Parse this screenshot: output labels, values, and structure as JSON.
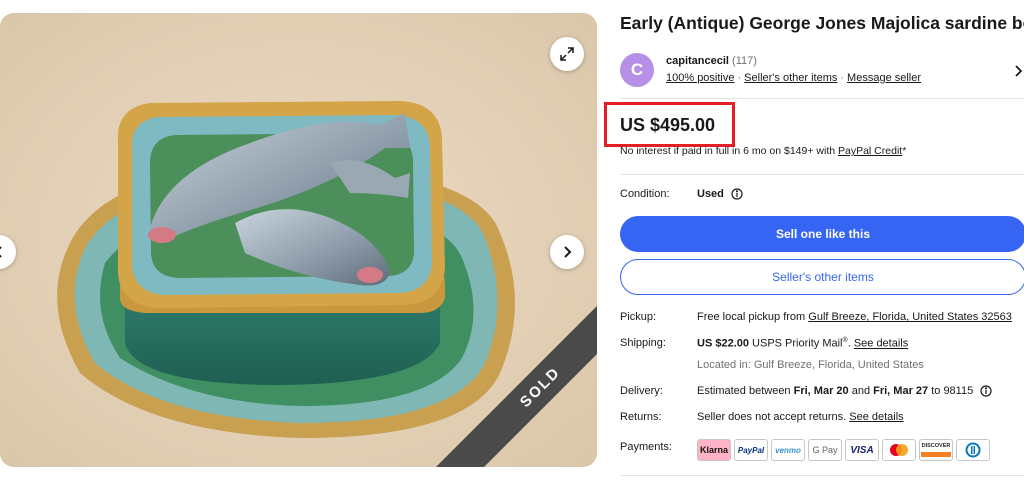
{
  "listing": {
    "title": "Early (Antique) George Jones Majolica sardine box",
    "sold_label": "SOLD"
  },
  "seller": {
    "avatar_letter": "C",
    "name": "capitancecil",
    "feedback_count": "(117)",
    "positive": "100% positive",
    "other_items_link": "Seller's other items",
    "message_link": "Message seller"
  },
  "price": {
    "amount": "US $495.00",
    "financing_text": "No interest if paid in full in 6 mo on $149+ with ",
    "financing_link": "PayPal Credit",
    "financing_suffix": "*",
    "highlight_color": "#e31e24"
  },
  "condition": {
    "label": "Condition:",
    "value": "Used"
  },
  "buttons": {
    "primary": "Sell one like this",
    "secondary": "Seller's other items"
  },
  "details": {
    "pickup_label": "Pickup:",
    "pickup_text": "Free local pickup from ",
    "pickup_link": "Gulf Breeze, Florida, United States 32563",
    "shipping_label": "Shipping:",
    "shipping_price": "US $22.00",
    "shipping_service": " USPS Priority Mail",
    "shipping_reg": "®",
    "shipping_dot": ". ",
    "shipping_link": "See details",
    "location": "Located in: Gulf Breeze, Florida, United States",
    "delivery_label": "Delivery:",
    "delivery_prefix": "Estimated between ",
    "delivery_start": "Fri, Mar 20",
    "delivery_and": " and ",
    "delivery_end": "Fri, Mar 27",
    "delivery_suffix": " to 98115",
    "returns_label": "Returns:",
    "returns_text": "Seller does not accept returns. ",
    "returns_link": "See details",
    "payments_label": "Payments:"
  },
  "payments": [
    {
      "name": "Klarna",
      "icon": "klarna-icon",
      "color": "#ffb3c7",
      "text_color": "#17120f"
    },
    {
      "name": "PayPal",
      "icon": "paypal-icon",
      "color": "#ffffff",
      "text_color": "#003087"
    },
    {
      "name": "venmo",
      "icon": "venmo-icon",
      "color": "#ffffff",
      "text_color": "#3d95ce"
    },
    {
      "name": "G Pay",
      "icon": "google-pay-icon",
      "color": "#ffffff",
      "text_color": "#5f6368"
    },
    {
      "name": "VISA",
      "icon": "visa-icon",
      "color": "#ffffff",
      "text_color": "#1a1f71"
    },
    {
      "name": "",
      "icon": "mastercard-icon",
      "color": "#ffffff",
      "text_color": "#000000"
    },
    {
      "name": "DISCOVER",
      "icon": "discover-icon",
      "color": "#ffffff",
      "text_color": "#231f20"
    },
    {
      "name": "",
      "icon": "diners-club-icon",
      "color": "#ffffff",
      "text_color": "#0079be"
    }
  ]
}
